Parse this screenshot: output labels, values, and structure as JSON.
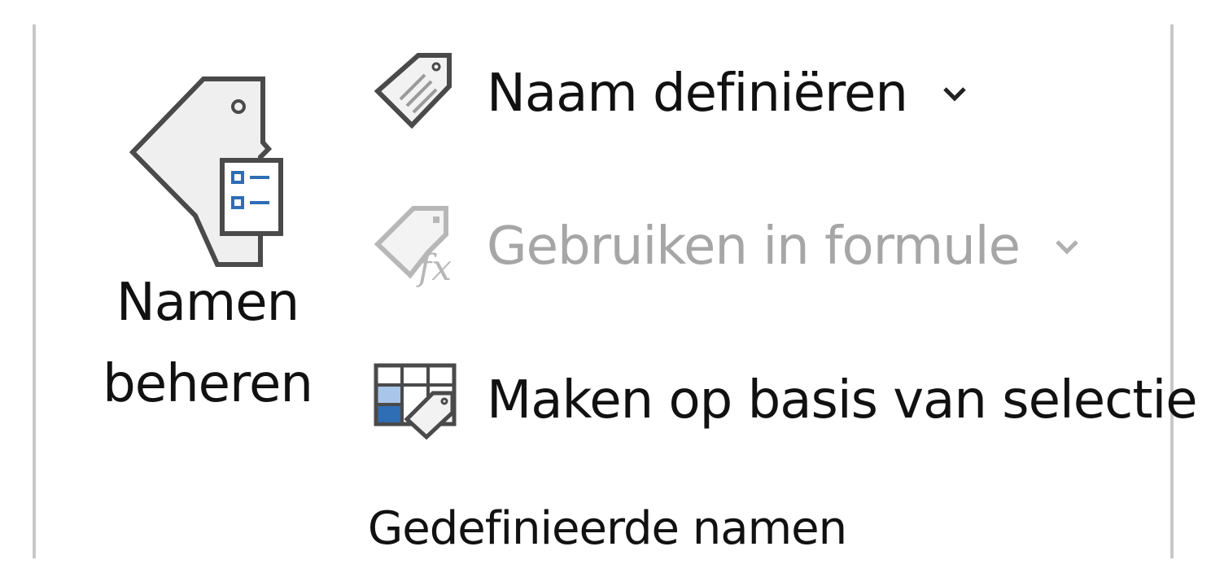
{
  "ribbon_group": {
    "title": "Gedefinieerde namen",
    "manage_button": {
      "label_line1": "Namen",
      "label_line2": "beheren",
      "icon": "name-manager-icon"
    },
    "commands": [
      {
        "label": "Naam definiëren",
        "icon": "tag-icon",
        "has_dropdown": true,
        "enabled": true
      },
      {
        "label": "Gebruiken in formule",
        "icon": "tag-fx-icon",
        "has_dropdown": true,
        "enabled": false
      },
      {
        "label": "Maken op basis van selectie",
        "icon": "table-tag-icon",
        "has_dropdown": false,
        "enabled": true
      }
    ]
  },
  "colors": {
    "accent": "#2f6db5",
    "accent_light": "#a9c6ea",
    "text": "#111111",
    "disabled_text": "#a6a6a6",
    "divider": "#c8c8c8"
  }
}
